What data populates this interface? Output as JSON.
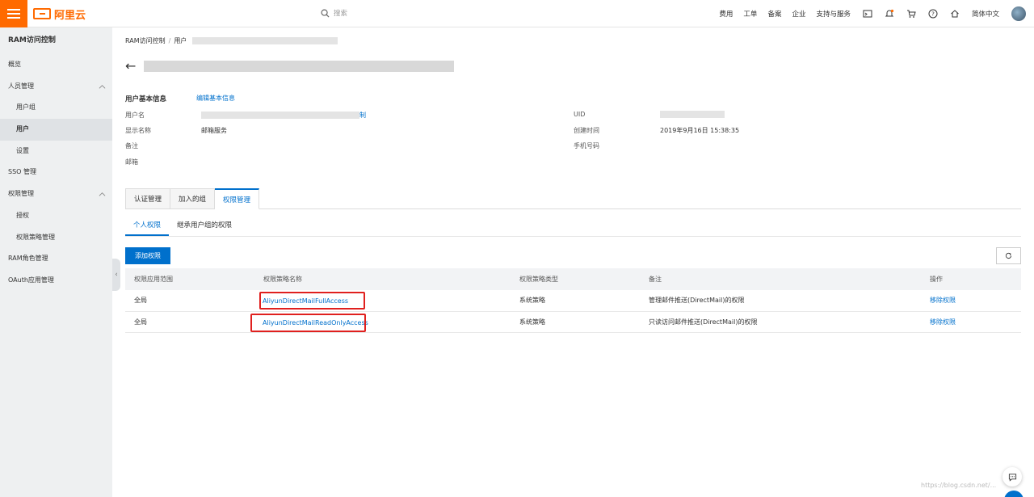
{
  "topbar": {
    "logo_text": "阿里云",
    "search_placeholder": "搜索",
    "nav": [
      "费用",
      "工单",
      "备案",
      "企业",
      "支持与服务"
    ],
    "icons": [
      "terminal-icon",
      "bell-icon",
      "cart-icon",
      "help-icon",
      "home-icon"
    ],
    "language": "简体中文"
  },
  "sidebar": {
    "title": "RAM访问控制",
    "items": {
      "overview": "概览",
      "people": "人员管理",
      "groups": "用户组",
      "users": "用户",
      "settings": "设置",
      "sso": "SSO 管理",
      "permissions": "权限管理",
      "grant": "授权",
      "policies": "权限策略管理",
      "roles": "RAM角色管理",
      "oauth": "OAuth应用管理"
    }
  },
  "breadcrumb": {
    "root": "RAM访问控制",
    "sep": "/",
    "current": "用户"
  },
  "basic_info": {
    "title": "用户基本信息",
    "edit_label": "编辑基本信息",
    "labels": {
      "username": "用户名",
      "display_name": "显示名称",
      "note": "备注",
      "email": "邮箱",
      "uid": "UID",
      "created": "创建时间",
      "phone": "手机号码"
    },
    "values": {
      "username_suffix": "制",
      "display_name": "邮箱服务",
      "created": "2019年9月16日 15:38:35"
    }
  },
  "tabs": [
    "认证管理",
    "加入的组",
    "权限管理"
  ],
  "subtabs": [
    "个人权限",
    "继承用户组的权限"
  ],
  "add_button": "添加权限",
  "table": {
    "headers": [
      "权限应用范围",
      "权限策略名称",
      "权限策略类型",
      "备注",
      "操作"
    ],
    "rows": [
      {
        "scope": "全局",
        "policy": "AliyunDirectMailFullAccess",
        "type": "系统策略",
        "note": "管理邮件推送(DirectMail)的权限",
        "action": "移除权限"
      },
      {
        "scope": "全局",
        "policy": "AliyunDirectMailReadOnlyAccess",
        "type": "系统策略",
        "note": "只读访问邮件推送(DirectMail)的权限",
        "action": "移除权限"
      }
    ]
  },
  "watermark": "https://blog.csdn.net/..."
}
